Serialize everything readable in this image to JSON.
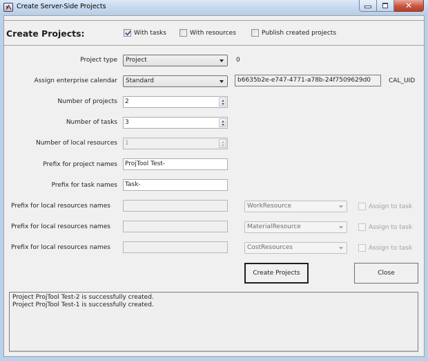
{
  "window": {
    "title": "Create Server-Side Projects",
    "icon": "app-icon",
    "controls": {
      "minimize": "minimize",
      "maximize": "maximize",
      "close": "✕"
    }
  },
  "header": {
    "title": "Create Projects:",
    "options": [
      {
        "label": "With tasks",
        "checked": true
      },
      {
        "label": "With resources",
        "checked": false
      },
      {
        "label": "Publish created projects",
        "checked": false
      }
    ]
  },
  "form": {
    "project_type": {
      "label": "Project type",
      "value": "Project",
      "code": "0"
    },
    "calendar": {
      "label": "Assign enterprise calendar",
      "value": "Standard",
      "uid": "b6635b2e-e747-4771-a78b-24f7509629d0",
      "uid_label": "CAL_UID"
    },
    "num_projects": {
      "label": "Number of projects",
      "value": "2"
    },
    "num_tasks": {
      "label": "Number of tasks",
      "value": "3"
    },
    "num_local_resources": {
      "label": "Number of local resources",
      "value": "1"
    },
    "project_prefix": {
      "label": "Prefix for project names",
      "value": "ProjTool Test-"
    },
    "task_prefix": {
      "label": "Prefix for task names",
      "value": "Task-"
    },
    "resource_rows": [
      {
        "label": "Prefix for local resources names",
        "value": "",
        "type": "WorkResource",
        "assign_label": "Assign to task",
        "assign_checked": false
      },
      {
        "label": "Prefix for local resources names",
        "value": "",
        "type": "MaterialResource",
        "assign_label": "Assign to task",
        "assign_checked": false
      },
      {
        "label": "Prefix for local resources names",
        "value": "",
        "type": "CostResources",
        "assign_label": "Assign to task",
        "assign_checked": false
      }
    ]
  },
  "buttons": {
    "create": "Create Projects",
    "close": "Close"
  },
  "log": {
    "lines": [
      "Project ProjTool Test-2 is successfully created.",
      "Project ProjTool Test-1 is successfully created."
    ]
  }
}
